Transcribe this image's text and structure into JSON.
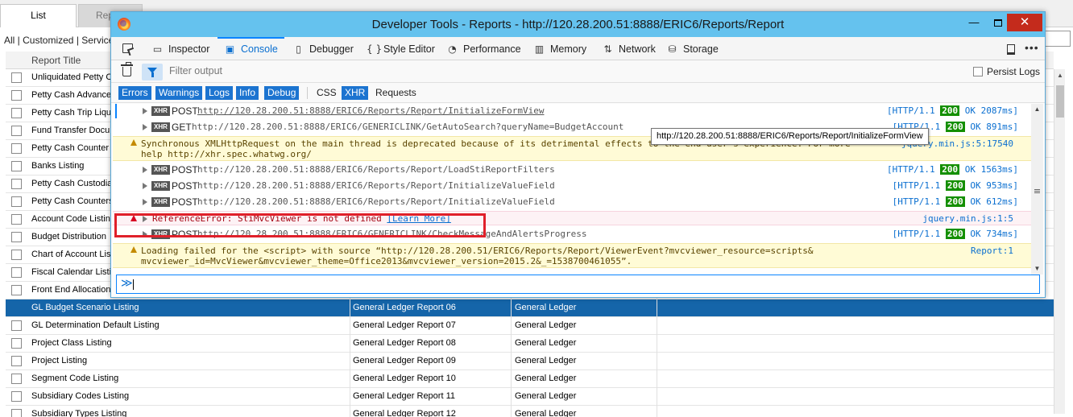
{
  "app": {
    "tabs": [
      {
        "label": "List"
      },
      {
        "label": "Report"
      }
    ],
    "breadcrumb": "All | Customized | Service",
    "column_header": "Report Title",
    "rows": [
      {
        "title": "Unliquidated Petty C",
        "report": "",
        "module": ""
      },
      {
        "title": "Petty Cash Advance",
        "report": "",
        "module": ""
      },
      {
        "title": "Petty Cash Trip Liqu",
        "report": "",
        "module": ""
      },
      {
        "title": "Fund Transfer Docu",
        "report": "",
        "module": ""
      },
      {
        "title": "Petty Cash Counter",
        "report": "",
        "module": ""
      },
      {
        "title": "Banks Listing",
        "report": "",
        "module": ""
      },
      {
        "title": "Petty Cash Custodia",
        "report": "",
        "module": ""
      },
      {
        "title": "Petty Cash Counters",
        "report": "",
        "module": ""
      },
      {
        "title": "Account Code Listin",
        "report": "",
        "module": ""
      },
      {
        "title": "Budget Distribution",
        "report": "",
        "module": ""
      },
      {
        "title": "Chart of Account Lis",
        "report": "",
        "module": ""
      },
      {
        "title": "Fiscal Calendar Listi",
        "report": "",
        "module": ""
      },
      {
        "title": "Front End Allocation",
        "report": "",
        "module": ""
      },
      {
        "title": "GL Budget Scenario Listing",
        "report": "General Ledger Report 06",
        "module": "General Ledger",
        "selected": true
      },
      {
        "title": "GL Determination Default Listing",
        "report": "General Ledger Report 07",
        "module": "General Ledger"
      },
      {
        "title": "Project Class Listing",
        "report": "General Ledger Report 08",
        "module": "General Ledger"
      },
      {
        "title": "Project Listing",
        "report": "General Ledger Report 09",
        "module": "General Ledger"
      },
      {
        "title": "Segment Code Listing",
        "report": "General Ledger Report 10",
        "module": "General Ledger"
      },
      {
        "title": "Subsidiary Codes Listing",
        "report": "General Ledger Report 11",
        "module": "General Ledger"
      },
      {
        "title": "Subsidiary Types Listing",
        "report": "General Ledger Report 12",
        "module": "General Ledger"
      }
    ]
  },
  "devtools": {
    "title": "Developer Tools - Reports - http://120.28.200.51:8888/ERIC6/Reports/Report",
    "win": {
      "minimize": "—",
      "close": "✕"
    },
    "tools": [
      {
        "label": "Inspector",
        "icon": "inspector-icon",
        "glyph": "▭"
      },
      {
        "label": "Console",
        "icon": "console-icon",
        "glyph": "▣",
        "active": true
      },
      {
        "label": "Debugger",
        "icon": "debugger-icon",
        "glyph": "▯"
      },
      {
        "label": "Style Editor",
        "icon": "style-editor-icon",
        "glyph": "{ }"
      },
      {
        "label": "Performance",
        "icon": "performance-icon",
        "glyph": "◔"
      },
      {
        "label": "Memory",
        "icon": "memory-icon",
        "glyph": "▥"
      },
      {
        "label": "Network",
        "icon": "network-icon",
        "glyph": "⇅"
      },
      {
        "label": "Storage",
        "icon": "storage-icon",
        "glyph": "⛁"
      }
    ],
    "more": "•••",
    "filter_placeholder": "Filter output",
    "persist_logs": "Persist Logs",
    "categories": [
      {
        "label": "Errors",
        "on": true
      },
      {
        "label": "Warnings",
        "on": true
      },
      {
        "label": "Logs",
        "on": true
      },
      {
        "label": "Info",
        "on": true
      },
      {
        "label": "Debug",
        "on": true
      },
      {
        "label": "CSS",
        "on": false
      },
      {
        "label": "XHR",
        "on": true
      },
      {
        "label": "Requests",
        "on": false
      }
    ],
    "messages": [
      {
        "kind": "xhr",
        "method": "POST",
        "url": "http://120.28.200.51:8888/ERIC6/Reports/Report/InitializeFormView",
        "proto": "[HTTP/1.1",
        "status": "200",
        "result": "OK 2087ms]",
        "underline": true
      },
      {
        "kind": "xhr",
        "method": "GET",
        "url": "http://120.28.200.51:8888/ERIC6/GENERICLINK/GetAutoSearch?queryName=BudgetAccount",
        "proto": "[HTTP/1.1",
        "status": "200",
        "result": "OK 891ms]"
      },
      {
        "kind": "warning",
        "text": "Synchronous XMLHttpRequest on the main thread is deprecated because of its detrimental effects to the end user’s experience. For more\nhelp http://xhr.spec.whatwg.org/",
        "source": "jquery.min.js:5:17540"
      },
      {
        "kind": "xhr",
        "method": "POST",
        "url": "http://120.28.200.51:8888/ERIC6/Reports/Report/LoadStiReportFilters",
        "proto": "[HTTP/1.1",
        "status": "200",
        "result": "OK 1563ms]"
      },
      {
        "kind": "xhr",
        "method": "POST",
        "url": "http://120.28.200.51:8888/ERIC6/Reports/Report/InitializeValueField",
        "proto": "[HTTP/1.1",
        "status": "200",
        "result": "OK 953ms]"
      },
      {
        "kind": "xhr",
        "method": "POST",
        "url": "http://120.28.200.51:8888/ERIC6/Reports/Report/InitializeValueField",
        "proto": "[HTTP/1.1",
        "status": "200",
        "result": "OK 612ms]"
      },
      {
        "kind": "error",
        "text": "ReferenceError: StiMvcViewer is not defined",
        "learn": "[Learn More]",
        "source": "jquery.min.js:1:5"
      },
      {
        "kind": "xhr",
        "method": "POST",
        "url": "http://120.28.200.51:8888/ERIC6/GENERICLINK/CheckMessageAndAlertsProgress",
        "proto": "[HTTP/1.1",
        "status": "200",
        "result": "OK 734ms]"
      },
      {
        "kind": "warning",
        "text": "Loading failed for the <script> with source “http://120.28.200.51/ERIC6/Reports/Report/ViewerEvent?mvcviewer_resource=scripts&\nmvcviewer_id=MvcViewer&mvcviewer_theme=Office2013&mvcviewer_version=2015.2&_=1538700461055”.",
        "source": "Report:1"
      }
    ],
    "tooltip": "http://120.28.200.51:8888/ERIC6/Reports/Report/InitializeFormView",
    "prompt": "≫"
  },
  "colors": {
    "titlebar": "#65c2ee",
    "selected_row": "#1565a9",
    "category_on": "#1c74d0",
    "status_ok": "#148f00",
    "annotation": "#e0202a"
  }
}
